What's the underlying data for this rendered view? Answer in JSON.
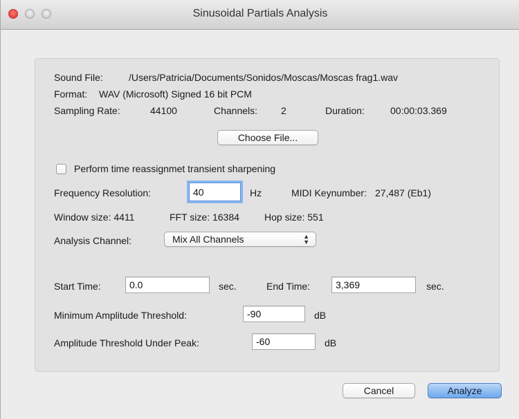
{
  "window": {
    "title": "Sinusoidal Partials Analysis"
  },
  "file": {
    "sound_file_label": "Sound File:",
    "sound_file_path": "/Users/Patricia/Documents/Sonidos/Moscas/Moscas frag1.wav",
    "format_label": "Format:",
    "format_value": "WAV (Microsoft) Signed 16 bit PCM",
    "sampling_rate_label": "Sampling Rate:",
    "sampling_rate_value": "44100",
    "channels_label": "Channels:",
    "channels_value": "2",
    "duration_label": "Duration:",
    "duration_value": "00:00:03.369",
    "choose_file_label": "Choose File..."
  },
  "options": {
    "sharpening_label": "Perform time reassignmet transient sharpening",
    "sharpening_checked": false,
    "freq_res_label": "Frequency Resolution:",
    "freq_res_value": "40",
    "freq_res_unit": "Hz",
    "midi_label": "MIDI Keynumber:",
    "midi_value": "27,487 (Eb1)",
    "window_size": "Window size: 4411",
    "fft_size": "FFT size: 16384",
    "hop_size": "Hop size: 551",
    "analysis_channel_label": "Analysis Channel:",
    "analysis_channel_value": "Mix All Channels"
  },
  "times": {
    "start_label": "Start Time:",
    "start_value": "0.0",
    "start_unit": "sec.",
    "end_label": "End Time:",
    "end_value": "3,369",
    "end_unit": "sec."
  },
  "thresholds": {
    "min_amp_label": "Minimum Amplitude Threshold:",
    "min_amp_value": "-90",
    "min_amp_unit": "dB",
    "under_peak_label": "Amplitude Threshold Under Peak:",
    "under_peak_value": "-60",
    "under_peak_unit": "dB"
  },
  "buttons": {
    "cancel": "Cancel",
    "analyze": "Analyze"
  },
  "colors": {
    "default_button": "#6ea8ec",
    "focus_ring": "#8ab7ef",
    "close_button": "#e0443e"
  }
}
